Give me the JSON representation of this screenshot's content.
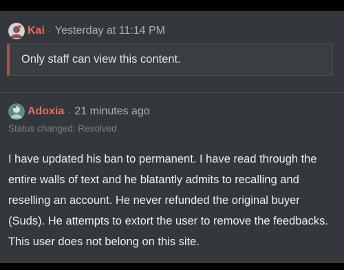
{
  "posts": [
    {
      "author": "Kai",
      "separator": "·",
      "timestamp": "Yesterday at 11:14 PM",
      "hidden_notice": "Only staff can view this content.",
      "avatar_icon": "user-avatar-icon"
    },
    {
      "author": "Adoxia",
      "separator": "·",
      "timestamp": "21 minutes ago",
      "status": "Status changed: Resolved",
      "body": "I have updated his ban to permanent. I have read through the entire walls of text and he blatantly admits to recalling and reselling an account. He never refunded the original buyer (Suds). He attempts to extort the user to remove the feedbacks. This user does not belong on this site.",
      "avatar_icon": "user-avatar-icon"
    }
  ],
  "colors": {
    "background": "#34373c",
    "author_name": "#ea6b5f",
    "staff_border": "#b94a45",
    "body_text": "#eef0f2",
    "muted_text": "#aeb2b8"
  }
}
